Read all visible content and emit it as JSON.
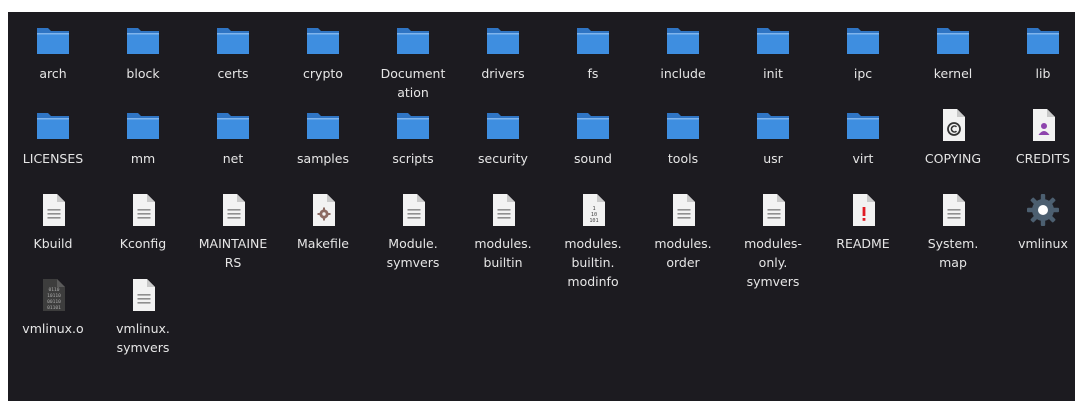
{
  "colors": {
    "background": "#1c1b20",
    "label": "#e6e6e6",
    "folder": "#3e8ee0",
    "folder_tab": "#2f75c4",
    "doc_page": "#f2f2f2",
    "doc_fold": "#c9c9c9",
    "doc_lines": "#8f8f8f",
    "readme_mark": "#e01b24",
    "credits_person": "#8e44ad",
    "makefile_gear": "#8b6a62",
    "binary_dark": "#3d3d3d",
    "gear_settings": "#4c5f70"
  },
  "items": [
    {
      "label": "arch",
      "icon": "folder-icon"
    },
    {
      "label": "block",
      "icon": "folder-icon"
    },
    {
      "label": "certs",
      "icon": "folder-icon"
    },
    {
      "label": "crypto",
      "icon": "folder-icon"
    },
    {
      "label": "Document\nation",
      "icon": "folder-icon"
    },
    {
      "label": "drivers",
      "icon": "folder-icon"
    },
    {
      "label": "fs",
      "icon": "folder-icon"
    },
    {
      "label": "include",
      "icon": "folder-icon"
    },
    {
      "label": "init",
      "icon": "folder-icon"
    },
    {
      "label": "ipc",
      "icon": "folder-icon"
    },
    {
      "label": "kernel",
      "icon": "folder-icon"
    },
    {
      "label": "lib",
      "icon": "folder-icon"
    },
    {
      "label": "LICENSES",
      "icon": "folder-icon"
    },
    {
      "label": "mm",
      "icon": "folder-icon"
    },
    {
      "label": "net",
      "icon": "folder-icon"
    },
    {
      "label": "samples",
      "icon": "folder-icon"
    },
    {
      "label": "scripts",
      "icon": "folder-icon"
    },
    {
      "label": "security",
      "icon": "folder-icon"
    },
    {
      "label": "sound",
      "icon": "folder-icon"
    },
    {
      "label": "tools",
      "icon": "folder-icon"
    },
    {
      "label": "usr",
      "icon": "folder-icon"
    },
    {
      "label": "virt",
      "icon": "folder-icon"
    },
    {
      "label": "COPYING",
      "icon": "copyright-file-icon"
    },
    {
      "label": "CREDITS",
      "icon": "contact-file-icon"
    },
    {
      "label": "Kbuild",
      "icon": "text-file-icon"
    },
    {
      "label": "Kconfig",
      "icon": "text-file-icon"
    },
    {
      "label": "MAINTAINE\nRS",
      "icon": "text-file-icon"
    },
    {
      "label": "Makefile",
      "icon": "makefile-icon"
    },
    {
      "label": "Module.\nsymvers",
      "icon": "text-file-icon"
    },
    {
      "label": "modules.\nbuiltin",
      "icon": "text-file-icon"
    },
    {
      "label": "modules.\nbuiltin.\nmodinfo",
      "icon": "binary-file-icon"
    },
    {
      "label": "modules.\norder",
      "icon": "text-file-icon"
    },
    {
      "label": "modules-\nonly.\nsymvers",
      "icon": "text-file-icon"
    },
    {
      "label": "README",
      "icon": "readme-file-icon"
    },
    {
      "label": "System.\nmap",
      "icon": "text-file-icon"
    },
    {
      "label": "vmlinux",
      "icon": "executable-gear-icon"
    },
    {
      "label": "vmlinux.o",
      "icon": "object-file-icon"
    },
    {
      "label": "vmlinux.\nsymvers",
      "icon": "text-file-icon"
    }
  ]
}
